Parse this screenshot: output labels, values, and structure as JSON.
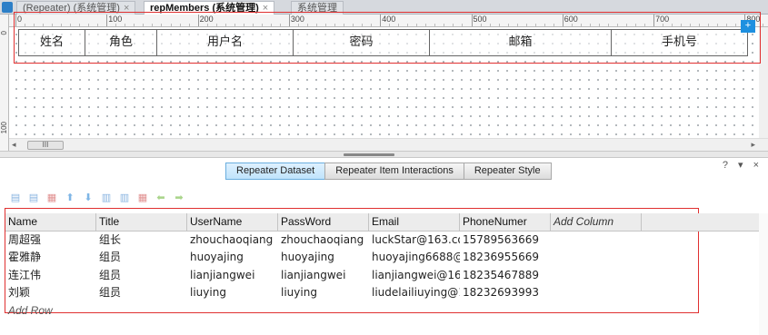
{
  "tabs": [
    {
      "label": "(Repeater) (系统管理)",
      "close": "×"
    },
    {
      "label": "repMembers (系统管理)",
      "close": "×"
    },
    {
      "label": "系统管理",
      "close": ""
    }
  ],
  "ruler": {
    "top_labels": [
      "0",
      "100",
      "200",
      "300",
      "400",
      "500",
      "600",
      "700",
      "800"
    ],
    "left_labels": [
      "0",
      "100"
    ]
  },
  "canvas_table": {
    "headers": [
      "姓名",
      "角色",
      "用户名",
      "密码",
      "邮箱",
      "手机号"
    ],
    "marker": "+"
  },
  "canvas_scroll": {
    "thumb_label": "III",
    "left_arrow": "◂",
    "right_arrow": "▸"
  },
  "panel": {
    "controls": "? ▾ ×",
    "subtabs": [
      "Repeater Dataset",
      "Repeater Item Interactions",
      "Repeater Style"
    ],
    "active_subtab": "Repeater Dataset",
    "toolbar_icons": [
      {
        "name": "insert-row-above-icon",
        "glyph": "▤"
      },
      {
        "name": "insert-row-below-icon",
        "glyph": "▤"
      },
      {
        "name": "delete-row-icon",
        "glyph": "▦"
      },
      {
        "name": "move-up-icon",
        "glyph": "⬆"
      },
      {
        "name": "move-down-icon",
        "glyph": "⬇"
      },
      {
        "name": "insert-column-left-icon",
        "glyph": "▥"
      },
      {
        "name": "insert-column-right-icon",
        "glyph": "▥"
      },
      {
        "name": "delete-column-icon",
        "glyph": "▦"
      },
      {
        "name": "move-left-icon",
        "glyph": "⬅"
      },
      {
        "name": "move-right-icon",
        "glyph": "➡"
      }
    ],
    "dataset": {
      "columns": [
        "Name",
        "Title",
        "UserName",
        "PassWord",
        "Email",
        "PhoneNumer"
      ],
      "add_column": "Add Column",
      "rows": [
        [
          "周超强",
          "组长",
          "zhouchaoqiang",
          "zhouchaoqiang",
          "luckStar@163.co",
          "15789563669"
        ],
        [
          "霍雅静",
          "组员",
          "huoyajing",
          "huoyajing",
          "huoyajing6688@1",
          "18236955669"
        ],
        [
          "连江伟",
          "组员",
          "lianjiangwei",
          "lianjiangwei",
          "lianjiangwei@163",
          "18235467889"
        ],
        [
          "刘颖",
          "组员",
          "liuying",
          "liuying",
          "liudelailiuying@1",
          "18232693993"
        ]
      ],
      "add_row": "Add Row"
    }
  },
  "colors": {
    "highlight": "#e03030",
    "active_tab": "#bfe3fb",
    "accent": "#1e90e0"
  }
}
